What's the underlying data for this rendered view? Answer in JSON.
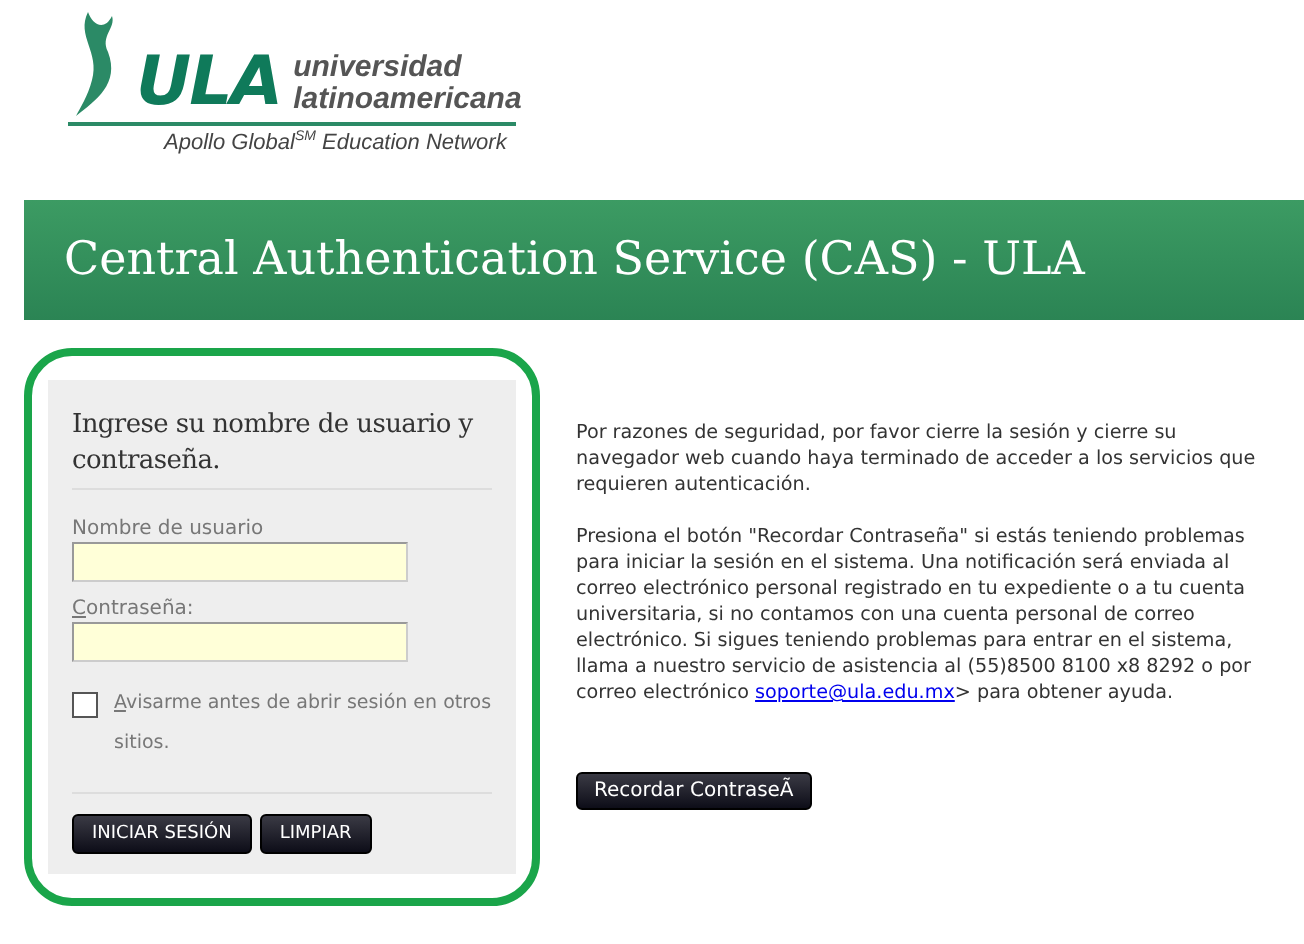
{
  "logo": {
    "mark": "ULA",
    "line_1": "universidad",
    "line_2": "latinoamericana",
    "tagline": "Apollo Global$^{SM}$ Education Network"
  },
  "banner": {
    "title": "Central Authentication Service (CAS) - ULA"
  },
  "login": {
    "heading": "Ingrese su nombre de usuario y contraseña.",
    "fields": [
      {
        "label": "Nombre de usuario"
      },
      {
        "label": "Contraseña:"
      }
    ],
    "warn": {
      "label": "Avisarme antes de abrir sesión en otros sitios.",
      "checked": false
    },
    "buttons": [
      "INICIAR SESIÓN",
      "LIMPIAR"
    ]
  },
  "info": {
    "paragraph_1": "Por razones de seguridad, por favor cierre la sesión y cierre su navegador web cuando haya terminado de acceder a los servicios que requieren autenticación.",
    "paragraph_2": {
      "before": "Presiona el botón \"Recordar Contraseña\" si estás teniendo problemas para iniciar la sesión en el sistema. Una notificación será enviada al correo electrónico personal registrado en tu expediente o a tu cuenta universitaria, si no contamos con una cuenta personal de correo electrónico. Si sigues teniendo problemas para entrar en el sistema, llama a nuestro servicio de asistencia al (55)8500 8100 x8 8292 o por correo electrónico ",
      "link": "soporte@ula.edu.mx",
      "after": "> para obtener ayuda."
    },
    "button": "Recordar ContraseÃ"
  }
}
